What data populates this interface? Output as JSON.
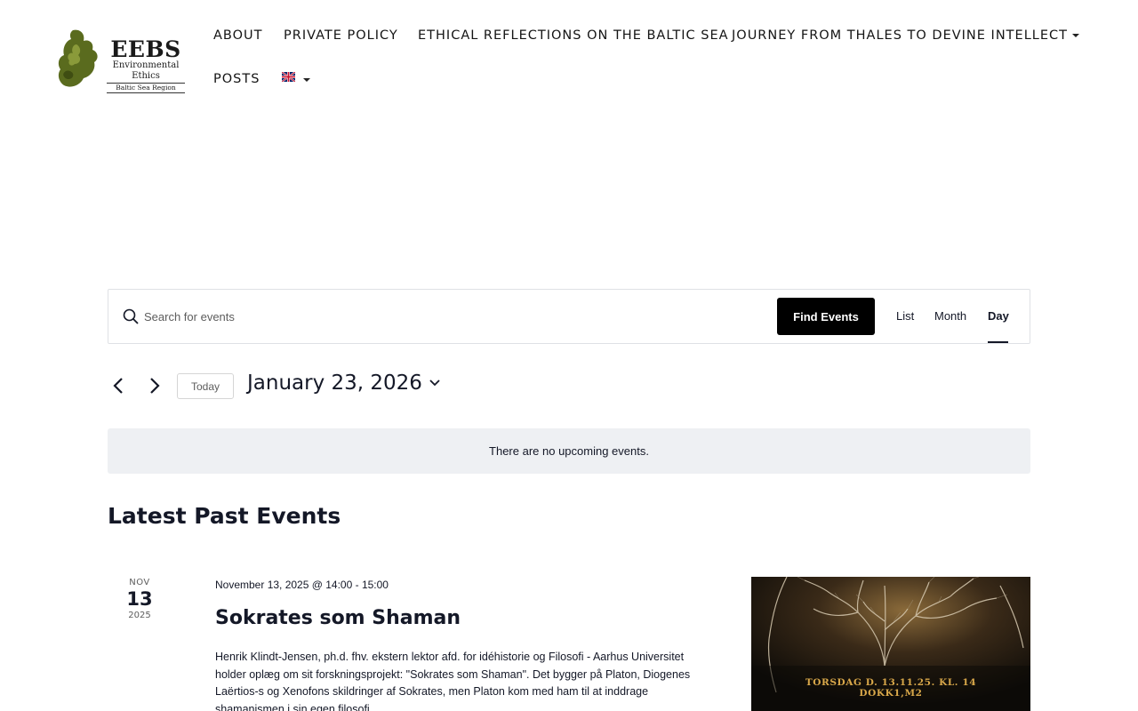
{
  "logo": {
    "title": "EEBS",
    "subtitle": "Environmental Ethics",
    "region": "Baltic Sea Region"
  },
  "nav": {
    "items": [
      {
        "label": "ABOUT"
      },
      {
        "label": "PRIVATE POLICY"
      },
      {
        "label": "ETHICAL REFLECTIONS ON THE BALTIC SEA"
      },
      {
        "label": "JOURNEY FROM THALES TO DEVINE INTELLECT"
      },
      {
        "label": "POSTS"
      }
    ],
    "language_icon": "uk-flag-icon"
  },
  "search": {
    "placeholder": "Search for events",
    "value": "",
    "find_label": "Find Events",
    "views": [
      {
        "label": "List"
      },
      {
        "label": "Month"
      },
      {
        "label": "Day"
      }
    ],
    "active_view": "Day"
  },
  "date_nav": {
    "today_label": "Today",
    "current_date": "January 23, 2026"
  },
  "notice": "There are no upcoming events.",
  "past_events": {
    "title": "Latest Past Events",
    "events": [
      {
        "month": "NOV",
        "day": "13",
        "year": "2025",
        "datetime": "November 13, 2025 @ 14:00 - 15:00",
        "title": "Sokrates som Shaman",
        "description": "Henrik Klindt-Jensen, ph.d. fhv. ekstern lektor afd. for idéhistorie og Filosofi - Aarhus Universitet holder oplæg om sit forskningsprojekt: \"Sokrates som Shaman\". Det bygger på Platon, Diogenes Laërtios-s og Xenofons skildringer af Sokrates, men Platon kom med ham til at inddrage shamanismen i sin egen filosofi.",
        "image_caption_1": "TORSDAG D. 13.11.25. KL. 14",
        "image_caption_2": "DOKK1,M2"
      }
    ]
  },
  "colors": {
    "primary_button": "#000000",
    "text": "#141827",
    "notice_bg": "#eef0f3"
  }
}
